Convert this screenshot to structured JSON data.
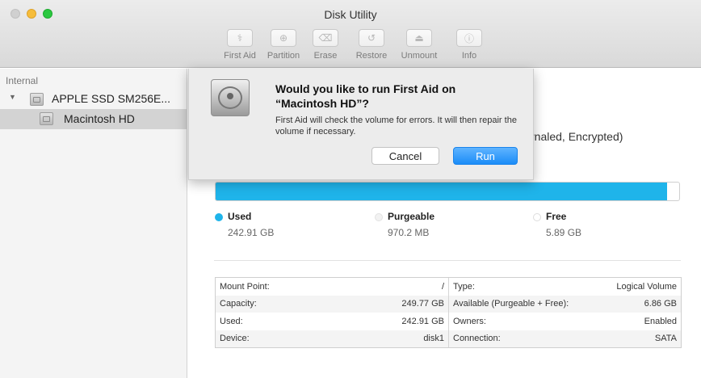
{
  "window": {
    "title": "Disk Utility"
  },
  "toolbar": {
    "items": [
      {
        "label": "First Aid",
        "icon": "stethoscope-icon",
        "glyph": "⚕"
      },
      {
        "label": "Partition",
        "icon": "partition-icon",
        "glyph": "⊕"
      },
      {
        "label": "Erase",
        "icon": "erase-icon",
        "glyph": "⌫"
      },
      {
        "label": "Restore",
        "icon": "restore-icon",
        "glyph": "↺"
      },
      {
        "label": "Unmount",
        "icon": "unmount-icon",
        "glyph": "⏏"
      },
      {
        "label": "Info",
        "icon": "info-icon",
        "glyph": "ⓘ"
      }
    ]
  },
  "sidebar": {
    "section": "Internal",
    "disk": {
      "name": "APPLE SSD SM256E...",
      "icon": "hard-disk-icon"
    },
    "volume": {
      "name": "Macintosh HD",
      "icon": "hard-disk-icon",
      "selected": true
    }
  },
  "main": {
    "header_partial": "rnaled, Encrypted)",
    "usage": {
      "used_fraction": 0.974,
      "used_color": "#1fb4ea",
      "legend": [
        {
          "title": "Used",
          "value": "242.91 GB",
          "color": "#1fb4ea"
        },
        {
          "title": "Purgeable",
          "value": "970.2 MB",
          "color": "#f2f2f2"
        },
        {
          "title": "Free",
          "value": "5.89 GB",
          "color": "#ffffff"
        }
      ]
    },
    "info_rows": [
      {
        "l_label": "Mount Point:",
        "l_value": "/",
        "r_label": "Type:",
        "r_value": "Logical Volume"
      },
      {
        "l_label": "Capacity:",
        "l_value": "249.77 GB",
        "r_label": "Available (Purgeable + Free):",
        "r_value": "6.86 GB"
      },
      {
        "l_label": "Used:",
        "l_value": "242.91 GB",
        "r_label": "Owners:",
        "r_value": "Enabled"
      },
      {
        "l_label": "Device:",
        "l_value": "disk1",
        "r_label": "Connection:",
        "r_value": "SATA"
      }
    ]
  },
  "dialog": {
    "title": "Would you like to run First Aid on “Macintosh HD”?",
    "message": "First Aid will check the volume for errors. It will then repair the volume if necessary.",
    "cancel_label": "Cancel",
    "run_label": "Run",
    "accent": "#1b8cf7"
  }
}
